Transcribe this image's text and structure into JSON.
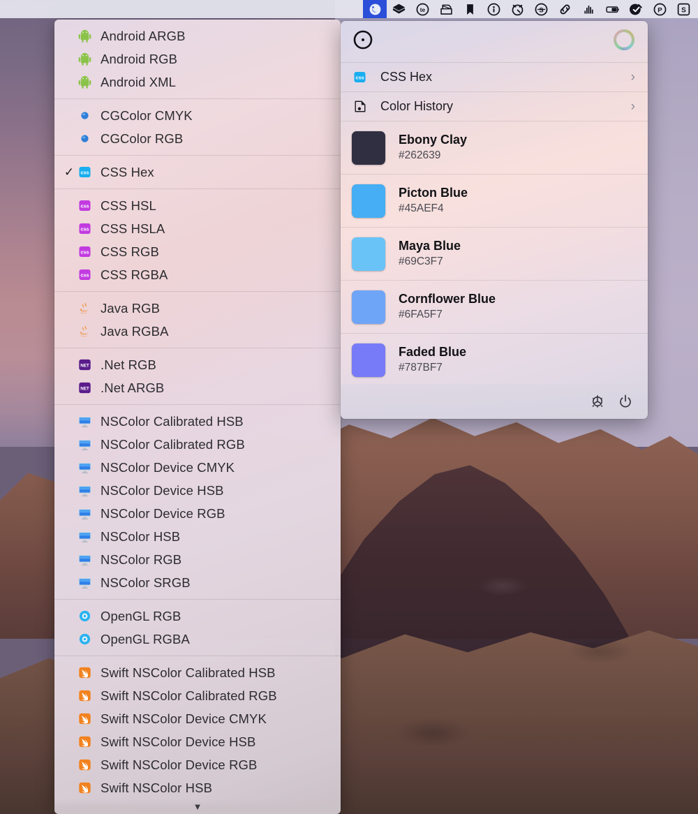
{
  "menubar": {
    "items": [
      {
        "name": "sip-color-picker",
        "icon": "sip-droplet-icon",
        "active": true
      },
      {
        "name": "layers-app",
        "icon": "layers-icon",
        "active": false
      },
      {
        "name": "textexpander",
        "icon": "te-circle-icon",
        "active": false
      },
      {
        "name": "scanner",
        "icon": "scanner-icon",
        "active": false
      },
      {
        "name": "bookmark",
        "icon": "bookmark-icon",
        "active": false
      },
      {
        "name": "info-circle",
        "icon": "info-circle-icon",
        "active": false
      },
      {
        "name": "timer",
        "icon": "alarm-clock-icon",
        "active": false
      },
      {
        "name": "spotify-circle",
        "icon": "s-circle-icon",
        "active": false
      },
      {
        "name": "link",
        "icon": "link-chain-icon",
        "active": false
      },
      {
        "name": "sound-levels",
        "icon": "audio-bars-icon",
        "active": false
      },
      {
        "name": "battery",
        "icon": "battery-icon",
        "active": false
      },
      {
        "name": "cleanmymac",
        "icon": "check-badge-icon",
        "active": false
      },
      {
        "name": "paypal",
        "icon": "p-circle-icon",
        "active": false
      },
      {
        "name": "setapp",
        "icon": "s-square-icon",
        "active": false
      }
    ]
  },
  "format_menu": {
    "scroll_arrow": "▼",
    "checkmark": "✓",
    "groups": [
      {
        "id": "android",
        "items": [
          {
            "label": "Android ARGB",
            "icon": "android-icon",
            "checked": false
          },
          {
            "label": "Android RGB",
            "icon": "android-icon",
            "checked": false
          },
          {
            "label": "Android XML",
            "icon": "android-icon",
            "checked": false
          }
        ]
      },
      {
        "id": "cgcolor",
        "items": [
          {
            "label": "CGColor CMYK",
            "icon": "blue-dot-icon",
            "checked": false
          },
          {
            "label": "CGColor RGB",
            "icon": "blue-dot-icon",
            "checked": false
          }
        ]
      },
      {
        "id": "css-hex",
        "items": [
          {
            "label": "CSS Hex",
            "icon": "css-blue-icon",
            "checked": true
          }
        ]
      },
      {
        "id": "css",
        "items": [
          {
            "label": "CSS HSL",
            "icon": "css-purple-icon",
            "checked": false
          },
          {
            "label": "CSS HSLA",
            "icon": "css-purple-icon",
            "checked": false
          },
          {
            "label": "CSS RGB",
            "icon": "css-purple-icon",
            "checked": false
          },
          {
            "label": "CSS RGBA",
            "icon": "css-purple-icon",
            "checked": false
          }
        ]
      },
      {
        "id": "java",
        "items": [
          {
            "label": "Java RGB",
            "icon": "java-icon",
            "checked": false
          },
          {
            "label": "Java RGBA",
            "icon": "java-icon",
            "checked": false
          }
        ]
      },
      {
        "id": "dotnet",
        "items": [
          {
            "label": ".Net RGB",
            "icon": "dotnet-icon",
            "checked": false
          },
          {
            "label": ".Net ARGB",
            "icon": "dotnet-icon",
            "checked": false
          }
        ]
      },
      {
        "id": "nscolor",
        "items": [
          {
            "label": "NSColor Calibrated HSB",
            "icon": "display-icon",
            "checked": false
          },
          {
            "label": "NSColor Calibrated RGB",
            "icon": "display-icon",
            "checked": false
          },
          {
            "label": "NSColor Device CMYK",
            "icon": "display-icon",
            "checked": false
          },
          {
            "label": "NSColor Device HSB",
            "icon": "display-icon",
            "checked": false
          },
          {
            "label": "NSColor Device RGB",
            "icon": "display-icon",
            "checked": false
          },
          {
            "label": "NSColor HSB",
            "icon": "display-icon",
            "checked": false
          },
          {
            "label": "NSColor RGB",
            "icon": "display-icon",
            "checked": false
          },
          {
            "label": "NSColor SRGB",
            "icon": "display-icon",
            "checked": false
          }
        ]
      },
      {
        "id": "opengl",
        "items": [
          {
            "label": "OpenGL RGB",
            "icon": "opengl-icon",
            "checked": false
          },
          {
            "label": "OpenGL RGBA",
            "icon": "opengl-icon",
            "checked": false
          }
        ]
      },
      {
        "id": "swift",
        "items": [
          {
            "label": "Swift NSColor Calibrated HSB",
            "icon": "swift-icon",
            "checked": false
          },
          {
            "label": "Swift NSColor Calibrated RGB",
            "icon": "swift-icon",
            "checked": false
          },
          {
            "label": "Swift NSColor Device CMYK",
            "icon": "swift-icon",
            "checked": false
          },
          {
            "label": "Swift NSColor Device HSB",
            "icon": "swift-icon",
            "checked": false
          },
          {
            "label": "Swift NSColor Device RGB",
            "icon": "swift-icon",
            "checked": false
          },
          {
            "label": "Swift NSColor HSB",
            "icon": "swift-icon",
            "checked": false
          }
        ]
      }
    ]
  },
  "color_popover": {
    "header": {
      "picker_icon": "target-circle-icon",
      "wheel_icon": "color-wheel-icon"
    },
    "rows": [
      {
        "label": "CSS Hex",
        "icon": "css-blue-icon",
        "chevron": "›"
      },
      {
        "label": "Color History",
        "icon": "color-history-icon",
        "chevron": "›"
      }
    ],
    "history": [
      {
        "name": "Ebony Clay",
        "hex": "#262639",
        "swatch": "#2F2F41"
      },
      {
        "name": "Picton Blue",
        "hex": "#45AEF4",
        "swatch": "#45AEF4"
      },
      {
        "name": "Maya Blue",
        "hex": "#69C3F7",
        "swatch": "#69C3F7"
      },
      {
        "name": "Cornflower Blue",
        "hex": "#6FA5F7",
        "swatch": "#6FA5F7"
      },
      {
        "name": "Faded Blue",
        "hex": "#787BF7",
        "swatch": "#787BF7"
      }
    ],
    "footer": [
      {
        "name": "preferences-gear-icon"
      },
      {
        "name": "power-quit-icon"
      }
    ]
  }
}
